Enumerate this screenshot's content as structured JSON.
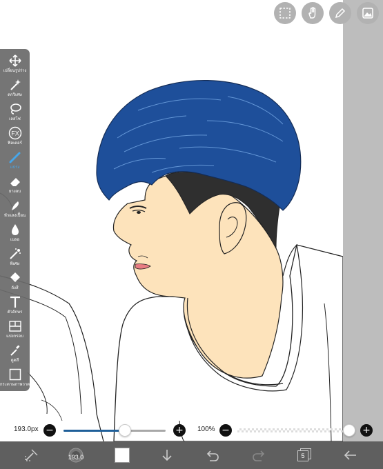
{
  "toolbar": {
    "tools": [
      {
        "label": "เปลี่ยนรูปร่าง",
        "icon": "move-icon"
      },
      {
        "label": "ตกวิเศษ",
        "icon": "magic-wand-icon"
      },
      {
        "label": "เลสโซ่",
        "icon": "lasso-icon"
      },
      {
        "label": "ฟิลเตอร์",
        "icon": "fx-icon"
      },
      {
        "label": "แปรง",
        "icon": "brush-icon"
      },
      {
        "label": "ยางลบ",
        "icon": "eraser-icon"
      },
      {
        "label": "หัวแสงเปื้อน",
        "icon": "smudge-icon"
      },
      {
        "label": "เบลอ",
        "icon": "blur-icon"
      },
      {
        "label": "พิเศษ",
        "icon": "special-icon"
      },
      {
        "label": "ถังสี",
        "icon": "fill-bucket-icon"
      },
      {
        "label": "ตัวอักษร",
        "icon": "text-icon"
      },
      {
        "label": "แบ่งกรอบ",
        "icon": "frame-divider-icon"
      },
      {
        "label": "ดูดสี",
        "icon": "eyedropper-icon"
      },
      {
        "label": "กระดาษภาพวาด",
        "icon": "canvas-icon"
      }
    ],
    "active_tool": "แปรง"
  },
  "top_buttons": [
    "selection-icon",
    "hand-icon",
    "pen-icon",
    "image-icon"
  ],
  "slider_row": {
    "brush_size": "193.0px",
    "brush_size_fraction": 0.6,
    "opacity": "100%",
    "opacity_fraction": 1.0
  },
  "bottom_bar": {
    "brush_size_label": "193.0",
    "color": "#ffffff",
    "layer_count": "5",
    "icons": [
      "transform-icon",
      "brush-preview-icon",
      "color-swatch",
      "download-icon",
      "undo-icon",
      "redo-icon",
      "layers-icon",
      "back-icon"
    ]
  },
  "colors": {
    "accent": "#3aa0e8",
    "hair": "#1e4f9a",
    "skin": "#fde3bb",
    "undercut": "#2f2f2f",
    "margin": "#bdbdbd",
    "bottom_bar": "#5f5f5f"
  }
}
